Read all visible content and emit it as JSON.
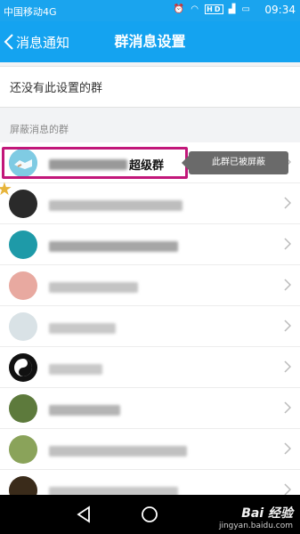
{
  "status_bar": {
    "carrier": "中国移动4G",
    "icons": [
      "alarm-icon",
      "wifi-icon",
      "hd-icon",
      "signal-icon",
      "battery-icon"
    ],
    "hd_label": "HD",
    "time": "09:34"
  },
  "title_bar": {
    "back_label": "消息通知",
    "title": "群消息设置"
  },
  "no_setting_text": "还没有此设置的群",
  "section_header": "屏蔽消息的群",
  "groups": [
    {
      "name_visible": "超级群",
      "avatar_color": "#6bc1dd",
      "highlighted": true
    },
    {
      "name_visible": "",
      "avatar_color": "#2a2a2a"
    },
    {
      "name_visible": "",
      "avatar_color": "#1e9aa8"
    },
    {
      "name_visible": "",
      "avatar_color": "#e8a9a0"
    },
    {
      "name_visible": "",
      "avatar_color": "#d9e2e6"
    },
    {
      "name_visible": "",
      "avatar_color": "#111111"
    },
    {
      "name_visible": "",
      "avatar_color": "#5d7a3c"
    },
    {
      "name_visible": "",
      "avatar_color": "#8aa35a"
    },
    {
      "name_visible": "",
      "avatar_color": "#3a2b1a"
    }
  ],
  "tooltip": "此群已被屏蔽",
  "watermark": {
    "text": "Bai 经验",
    "url": "jingyan.baidu.com"
  },
  "colors": {
    "header_blue": "#14a3f0",
    "highlight_border": "#c2177a",
    "tooltip_bg": "#6a6a6a"
  }
}
